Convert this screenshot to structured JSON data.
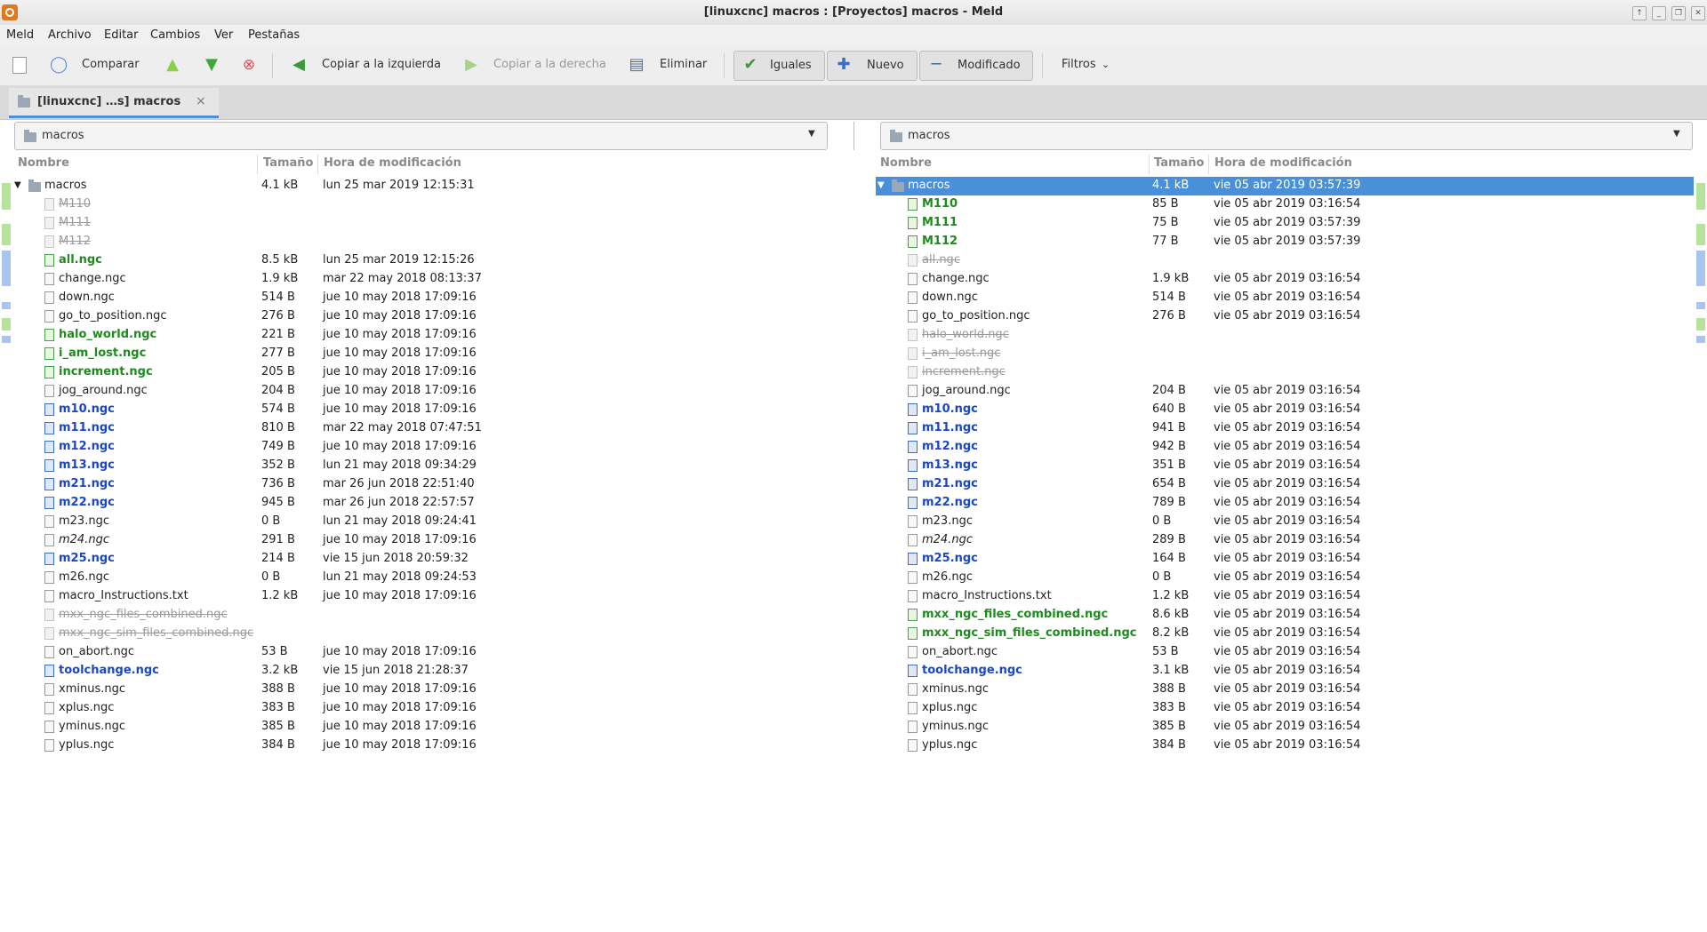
{
  "window": {
    "title": "[linuxcnc] macros : [Proyectos] macros - Meld",
    "controls": [
      "↑",
      "_",
      "❐",
      "✕"
    ]
  },
  "menu": [
    "Meld",
    "Archivo",
    "Editar",
    "Cambios",
    "Ver",
    "Pestañas"
  ],
  "toolbar": {
    "compare": "Comparar",
    "copy_left": "Copiar a la izquierda",
    "copy_right": "Copiar a la derecha",
    "delete": "Eliminar",
    "same": "Iguales",
    "new": "Nuevo",
    "modified": "Modificado",
    "filters": "Filtros"
  },
  "tab": {
    "label": "[linuxcnc] …s] macros",
    "close": "×"
  },
  "panes": {
    "left_path": "macros",
    "right_path": "macros",
    "headers": {
      "name": "Nombre",
      "size": "Tamaño",
      "mtime": "Hora de modificación"
    }
  },
  "left_rows": [
    {
      "name": "macros",
      "size": "4.1 kB",
      "mtime": "lun 25 mar 2019 12:15:31",
      "st": "folder"
    },
    {
      "name": "M110",
      "size": "",
      "mtime": "",
      "st": "miss"
    },
    {
      "name": "M111",
      "size": "",
      "mtime": "",
      "st": "miss"
    },
    {
      "name": "M112",
      "size": "",
      "mtime": "",
      "st": "miss"
    },
    {
      "name": "all.ngc",
      "size": "8.5 kB",
      "mtime": "lun 25 mar 2019 12:15:26",
      "st": "new"
    },
    {
      "name": "change.ngc",
      "size": "1.9 kB",
      "mtime": "mar 22 may 2018 08:13:37",
      "st": "same"
    },
    {
      "name": "down.ngc",
      "size": "514 B",
      "mtime": "jue 10 may 2018 17:09:16",
      "st": "same"
    },
    {
      "name": "go_to_position.ngc",
      "size": "276 B",
      "mtime": "jue 10 may 2018 17:09:16",
      "st": "same"
    },
    {
      "name": "halo_world.ngc",
      "size": "221 B",
      "mtime": "jue 10 may 2018 17:09:16",
      "st": "new"
    },
    {
      "name": "i_am_lost.ngc",
      "size": "277 B",
      "mtime": "jue 10 may 2018 17:09:16",
      "st": "new"
    },
    {
      "name": "increment.ngc",
      "size": "205 B",
      "mtime": "jue 10 may 2018 17:09:16",
      "st": "new"
    },
    {
      "name": "jog_around.ngc",
      "size": "204 B",
      "mtime": "jue 10 may 2018 17:09:16",
      "st": "same"
    },
    {
      "name": "m10.ngc",
      "size": "574 B",
      "mtime": "jue 10 may 2018 17:09:16",
      "st": "mod"
    },
    {
      "name": "m11.ngc",
      "size": "810 B",
      "mtime": "mar 22 may 2018 07:47:51",
      "st": "mod"
    },
    {
      "name": "m12.ngc",
      "size": "749 B",
      "mtime": "jue 10 may 2018 17:09:16",
      "st": "mod"
    },
    {
      "name": "m13.ngc",
      "size": "352 B",
      "mtime": "lun 21 may 2018 09:34:29",
      "st": "mod"
    },
    {
      "name": "m21.ngc",
      "size": "736 B",
      "mtime": "mar 26 jun 2018 22:51:40",
      "st": "mod"
    },
    {
      "name": "m22.ngc",
      "size": "945 B",
      "mtime": "mar 26 jun 2018 22:57:57",
      "st": "mod"
    },
    {
      "name": "m23.ngc",
      "size": "0 B",
      "mtime": "lun 21 may 2018 09:24:41",
      "st": "same"
    },
    {
      "name": "m24.ngc",
      "size": "291 B",
      "mtime": "jue 10 may 2018 17:09:16",
      "st": "it"
    },
    {
      "name": "m25.ngc",
      "size": "214 B",
      "mtime": "vie 15 jun 2018 20:59:32",
      "st": "mod"
    },
    {
      "name": "m26.ngc",
      "size": "0 B",
      "mtime": "lun 21 may 2018 09:24:53",
      "st": "same"
    },
    {
      "name": "macro_Instructions.txt",
      "size": "1.2 kB",
      "mtime": "jue 10 may 2018 17:09:16",
      "st": "same"
    },
    {
      "name": "mxx_ngc_files_combined.ngc",
      "size": "",
      "mtime": "",
      "st": "miss"
    },
    {
      "name": "mxx_ngc_sim_files_combined.ngc",
      "size": "",
      "mtime": "",
      "st": "miss"
    },
    {
      "name": "on_abort.ngc",
      "size": "53 B",
      "mtime": "jue 10 may 2018 17:09:16",
      "st": "same"
    },
    {
      "name": "toolchange.ngc",
      "size": "3.2 kB",
      "mtime": "vie 15 jun 2018 21:28:37",
      "st": "mod"
    },
    {
      "name": "xminus.ngc",
      "size": "388 B",
      "mtime": "jue 10 may 2018 17:09:16",
      "st": "same"
    },
    {
      "name": "xplus.ngc",
      "size": "383 B",
      "mtime": "jue 10 may 2018 17:09:16",
      "st": "same"
    },
    {
      "name": "yminus.ngc",
      "size": "385 B",
      "mtime": "jue 10 may 2018 17:09:16",
      "st": "same"
    },
    {
      "name": "yplus.ngc",
      "size": "384 B",
      "mtime": "jue 10 may 2018 17:09:16",
      "st": "same"
    }
  ],
  "right_rows": [
    {
      "name": "macros",
      "size": "4.1 kB",
      "mtime": "vie 05 abr 2019 03:57:39",
      "st": "folder"
    },
    {
      "name": "M110",
      "size": "85 B",
      "mtime": "vie 05 abr 2019 03:16:54",
      "st": "new"
    },
    {
      "name": "M111",
      "size": "75 B",
      "mtime": "vie 05 abr 2019 03:57:39",
      "st": "new"
    },
    {
      "name": "M112",
      "size": "77 B",
      "mtime": "vie 05 abr 2019 03:57:39",
      "st": "new"
    },
    {
      "name": "all.ngc",
      "size": "",
      "mtime": "",
      "st": "miss"
    },
    {
      "name": "change.ngc",
      "size": "1.9 kB",
      "mtime": "vie 05 abr 2019 03:16:54",
      "st": "same"
    },
    {
      "name": "down.ngc",
      "size": "514 B",
      "mtime": "vie 05 abr 2019 03:16:54",
      "st": "same"
    },
    {
      "name": "go_to_position.ngc",
      "size": "276 B",
      "mtime": "vie 05 abr 2019 03:16:54",
      "st": "same"
    },
    {
      "name": "halo_world.ngc",
      "size": "",
      "mtime": "",
      "st": "miss"
    },
    {
      "name": "i_am_lost.ngc",
      "size": "",
      "mtime": "",
      "st": "miss"
    },
    {
      "name": "increment.ngc",
      "size": "",
      "mtime": "",
      "st": "miss"
    },
    {
      "name": "jog_around.ngc",
      "size": "204 B",
      "mtime": "vie 05 abr 2019 03:16:54",
      "st": "same"
    },
    {
      "name": "m10.ngc",
      "size": "640 B",
      "mtime": "vie 05 abr 2019 03:16:54",
      "st": "mod"
    },
    {
      "name": "m11.ngc",
      "size": "941 B",
      "mtime": "vie 05 abr 2019 03:16:54",
      "st": "mod"
    },
    {
      "name": "m12.ngc",
      "size": "942 B",
      "mtime": "vie 05 abr 2019 03:16:54",
      "st": "mod"
    },
    {
      "name": "m13.ngc",
      "size": "351 B",
      "mtime": "vie 05 abr 2019 03:16:54",
      "st": "mod"
    },
    {
      "name": "m21.ngc",
      "size": "654 B",
      "mtime": "vie 05 abr 2019 03:16:54",
      "st": "mod"
    },
    {
      "name": "m22.ngc",
      "size": "789 B",
      "mtime": "vie 05 abr 2019 03:16:54",
      "st": "mod"
    },
    {
      "name": "m23.ngc",
      "size": "0 B",
      "mtime": "vie 05 abr 2019 03:16:54",
      "st": "same"
    },
    {
      "name": "m24.ngc",
      "size": "289 B",
      "mtime": "vie 05 abr 2019 03:16:54",
      "st": "it"
    },
    {
      "name": "m25.ngc",
      "size": "164 B",
      "mtime": "vie 05 abr 2019 03:16:54",
      "st": "mod"
    },
    {
      "name": "m26.ngc",
      "size": "0 B",
      "mtime": "vie 05 abr 2019 03:16:54",
      "st": "same"
    },
    {
      "name": "macro_Instructions.txt",
      "size": "1.2 kB",
      "mtime": "vie 05 abr 2019 03:16:54",
      "st": "same"
    },
    {
      "name": "mxx_ngc_files_combined.ngc",
      "size": "8.6 kB",
      "mtime": "vie 05 abr 2019 03:16:54",
      "st": "new"
    },
    {
      "name": "mxx_ngc_sim_files_combined.ngc",
      "size": "8.2 kB",
      "mtime": "vie 05 abr 2019 03:16:54",
      "st": "new"
    },
    {
      "name": "on_abort.ngc",
      "size": "53 B",
      "mtime": "vie 05 abr 2019 03:16:54",
      "st": "same"
    },
    {
      "name": "toolchange.ngc",
      "size": "3.1 kB",
      "mtime": "vie 05 abr 2019 03:16:54",
      "st": "mod"
    },
    {
      "name": "xminus.ngc",
      "size": "388 B",
      "mtime": "vie 05 abr 2019 03:16:54",
      "st": "same"
    },
    {
      "name": "xplus.ngc",
      "size": "383 B",
      "mtime": "vie 05 abr 2019 03:16:54",
      "st": "same"
    },
    {
      "name": "yminus.ngc",
      "size": "385 B",
      "mtime": "vie 05 abr 2019 03:16:54",
      "st": "same"
    },
    {
      "name": "yplus.ngc",
      "size": "384 B",
      "mtime": "vie 05 abr 2019 03:16:54",
      "st": "same"
    }
  ],
  "colors": {
    "new": "#1f8a1f",
    "modified": "#1a46c8",
    "missing": "#9a9a9a",
    "selection": "#4a90d9"
  },
  "icons": [
    "new-file-icon",
    "compare-icon",
    "prev-change-icon",
    "next-change-icon",
    "stop-icon",
    "copy-left-icon",
    "copy-right-icon",
    "delete-icon",
    "same-check-icon",
    "new-plus-icon",
    "modified-minus-icon",
    "chevron-down-icon",
    "folder-icon",
    "close-icon"
  ]
}
